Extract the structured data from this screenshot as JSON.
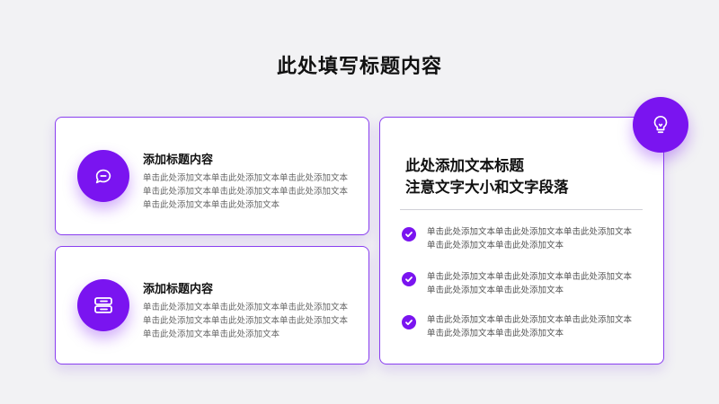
{
  "page": {
    "title": "此处填写标题内容"
  },
  "cards": [
    {
      "icon": "chat-bubble-icon",
      "title": "添加标题内容",
      "text": "单击此处添加文本单击此处添加文本单击此处添加文本单击此处添加文本单击此处添加文本单击此处添加文本单击此处添加文本单击此处添加文本"
    },
    {
      "icon": "stack-icon",
      "title": "添加标题内容",
      "text": "单击此处添加文本单击此处添加文本单击此处添加文本单击此处添加文本单击此处添加文本单击此处添加文本单击此处添加文本单击此处添加文本"
    }
  ],
  "right_card": {
    "icon": "lightbulb-icon",
    "title_line1": "此处添加文本标题",
    "title_line2": "注意文字大小和文字段落",
    "items": [
      {
        "text": "单击此处添加文本单击此处添加文本单击此处添加文本单击此处添加文本单击此处添加文本"
      },
      {
        "text": "单击此处添加文本单击此处添加文本单击此处添加文本单击此处添加文本单击此处添加文本"
      },
      {
        "text": "单击此处添加文本单击此处添加文本单击此处添加文本单击此处添加文本单击此处添加文本"
      }
    ]
  },
  "colors": {
    "accent": "#7a14f0",
    "border": "#8a3ff0",
    "background": "#f2f2f4"
  }
}
